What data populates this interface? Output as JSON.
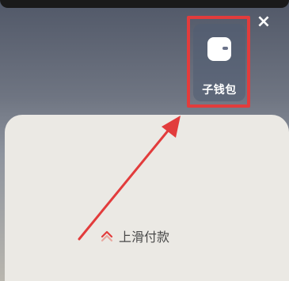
{
  "wallet": {
    "label": "子钱包"
  },
  "swipe": {
    "label": "上滑付款"
  },
  "close": {
    "symbol": "×"
  },
  "icons": [
    "wallet-icon",
    "close-icon",
    "chevron-up-icon"
  ],
  "colors": {
    "annotation_red": "#e23c3c",
    "panel": "#ebe9e4",
    "tile": "#505c73"
  }
}
